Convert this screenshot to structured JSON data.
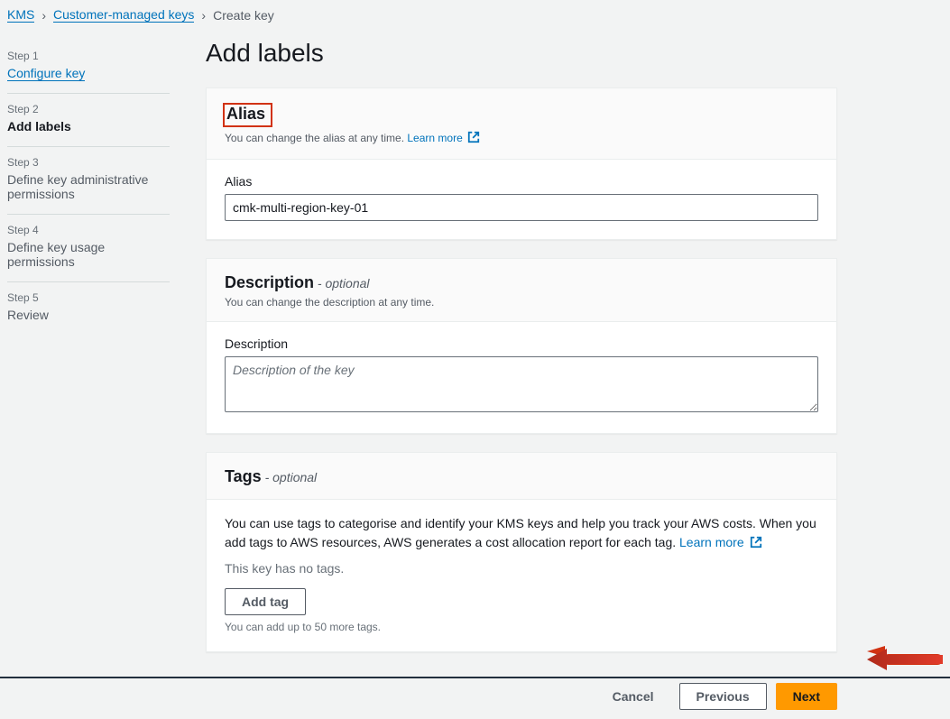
{
  "breadcrumb": {
    "root": "KMS",
    "parent": "Customer-managed keys",
    "current": "Create key"
  },
  "sidebar": {
    "steps": [
      {
        "num": "Step 1",
        "title": "Configure key",
        "state": "link"
      },
      {
        "num": "Step 2",
        "title": "Add labels",
        "state": "active"
      },
      {
        "num": "Step 3",
        "title": "Define key administrative permissions",
        "state": "normal"
      },
      {
        "num": "Step 4",
        "title": "Define key usage permissions",
        "state": "normal"
      },
      {
        "num": "Step 5",
        "title": "Review",
        "state": "normal"
      }
    ]
  },
  "page": {
    "title": "Add labels"
  },
  "alias_card": {
    "heading": "Alias",
    "sub": "You can change the alias at any time.",
    "learn_more": "Learn more",
    "field_label": "Alias",
    "value": "cmk-multi-region-key-01"
  },
  "description_card": {
    "heading": "Description",
    "optional": " - optional",
    "sub": "You can change the description at any time.",
    "field_label": "Description",
    "placeholder": "Description of the key",
    "value": ""
  },
  "tags_card": {
    "heading": "Tags",
    "optional": " - optional",
    "body": "You can use tags to categorise and identify your KMS keys and help you track your AWS costs. When you add tags to AWS resources, AWS generates a cost allocation report for each tag.",
    "learn_more": "Learn more",
    "empty": "This key has no tags.",
    "add_btn": "Add tag",
    "hint": "You can add up to 50 more tags."
  },
  "footer": {
    "cancel": "Cancel",
    "previous": "Previous",
    "next": "Next"
  },
  "colors": {
    "accent": "#ff9900",
    "link": "#0073bb",
    "highlight": "#d13212"
  }
}
